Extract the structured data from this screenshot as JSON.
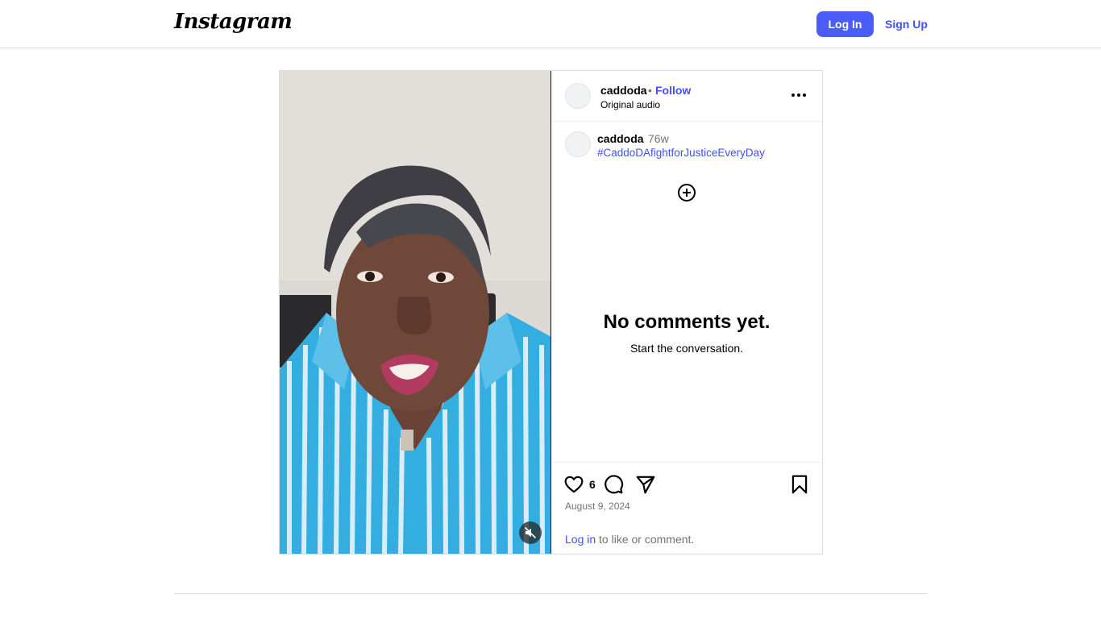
{
  "header": {
    "logo_text": "Instagram",
    "login_label": "Log In",
    "signup_label": "Sign Up"
  },
  "post": {
    "username": "caddoda",
    "follow_separator": "•",
    "follow_label": "Follow",
    "audio_label": "Original audio",
    "caption": {
      "username": "caddoda",
      "time_ago": "76w",
      "hashtag": "#CaddoDAfightforJusticeEveryDay"
    },
    "comments": {
      "empty_title": "No comments yet.",
      "empty_subtitle": "Start the conversation."
    },
    "likes": "6",
    "date": "August 9, 2024",
    "login_prompt": {
      "link": "Log in",
      "rest": " to like or comment."
    }
  },
  "colors": {
    "accent": "#4a5df9",
    "link": "#4150f7",
    "border": "#dbdbdb",
    "muted_text": "#737373",
    "shirt_blue": "#2fa9d6",
    "skin": "#6e4638",
    "hair": "#3e3e44"
  },
  "icons": {
    "more": "more-horizontal-icon",
    "new_comment": "plus-circle-icon",
    "like": "heart-icon",
    "comment": "comment-icon",
    "share": "paper-plane-icon",
    "save": "bookmark-icon",
    "mute": "speaker-muted-icon"
  }
}
